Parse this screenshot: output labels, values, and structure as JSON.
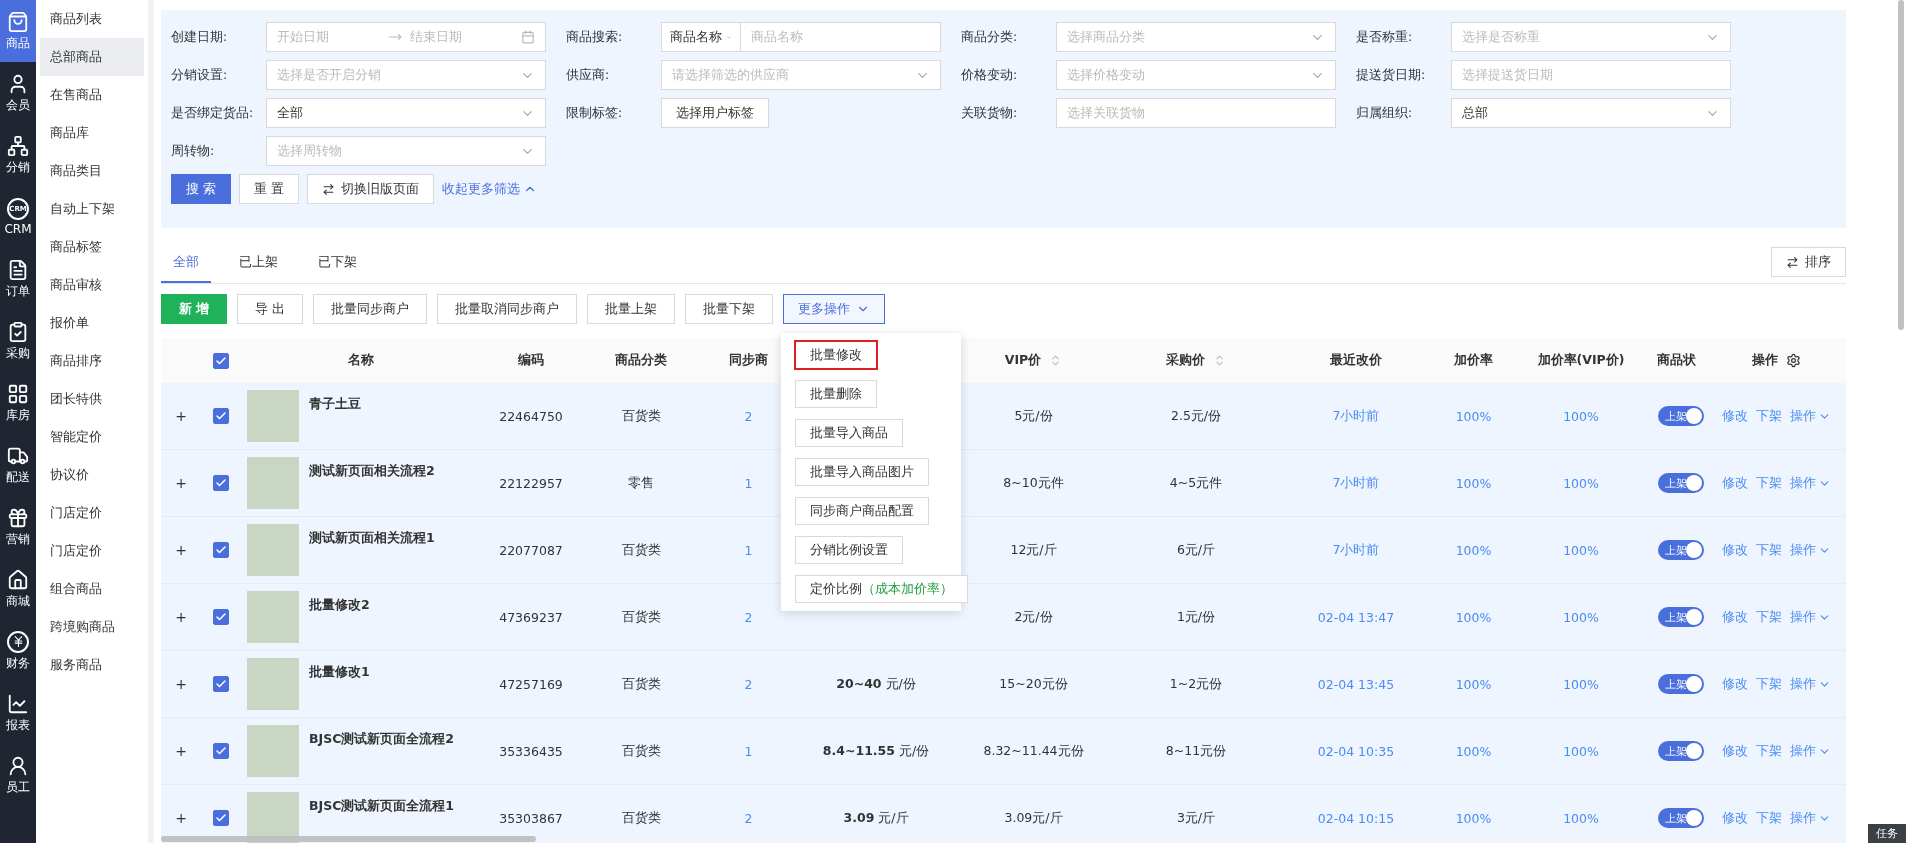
{
  "nav": [
    {
      "label": "商品",
      "selected": true
    },
    {
      "label": "会员",
      "selected": false
    },
    {
      "label": "分销",
      "selected": false
    },
    {
      "label": "CRM",
      "badge": "CRM",
      "selected": false
    },
    {
      "label": "订单",
      "selected": false
    },
    {
      "label": "采购",
      "selected": false
    },
    {
      "label": "库房",
      "selected": false
    },
    {
      "label": "配送",
      "selected": false
    },
    {
      "label": "营销",
      "selected": false
    },
    {
      "label": "商城",
      "selected": false
    },
    {
      "label": "财务",
      "selected": false
    },
    {
      "label": "报表",
      "selected": false
    },
    {
      "label": "员工",
      "selected": false
    }
  ],
  "submenu": [
    {
      "label": "商品列表",
      "selected": false
    },
    {
      "label": "总部商品",
      "selected": true
    },
    {
      "label": "在售商品",
      "selected": false
    },
    {
      "label": "商品库",
      "selected": false
    },
    {
      "label": "商品类目",
      "selected": false
    },
    {
      "label": "自动上下架",
      "selected": false
    },
    {
      "label": "商品标签",
      "selected": false
    },
    {
      "label": "商品审核",
      "selected": false
    },
    {
      "label": "报价单",
      "selected": false
    },
    {
      "label": "商品排序",
      "selected": false
    },
    {
      "label": "团长特供",
      "selected": false
    },
    {
      "label": "智能定价",
      "selected": false
    },
    {
      "label": "协议价",
      "selected": false
    },
    {
      "label": "门店定价",
      "selected": false
    },
    {
      "label": "门店定价",
      "selected": false
    },
    {
      "label": "组合商品",
      "selected": false
    },
    {
      "label": "跨境购商品",
      "selected": false
    },
    {
      "label": "服务商品",
      "selected": false
    }
  ],
  "filters": [
    {
      "label": "创建日期:",
      "kind": "daterange",
      "placeholder": "开始日期",
      "placeholder_end": "结束日期"
    },
    {
      "label": "商品搜索:",
      "kind": "combo",
      "value": "商品名称",
      "placeholder": "商品名称"
    },
    {
      "label": "商品分类:",
      "kind": "select",
      "placeholder": "选择商品分类"
    },
    {
      "label": "是否称重:",
      "kind": "select",
      "placeholder": "选择是否称重"
    },
    {
      "label": "分销设置:",
      "kind": "select",
      "placeholder": "选择是否开启分销"
    },
    {
      "label": "供应商:",
      "kind": "select",
      "placeholder": "请选择筛选的供应商"
    },
    {
      "label": "价格变动:",
      "kind": "select",
      "placeholder": "选择价格变动"
    },
    {
      "label": "提送货日期:",
      "kind": "input",
      "placeholder": "选择提送货日期"
    },
    {
      "label": "是否绑定货品:",
      "kind": "select",
      "value": "全部"
    },
    {
      "label": "限制标签:",
      "kind": "button",
      "value": "选择用户标签"
    },
    {
      "label": "关联货物:",
      "kind": "input",
      "placeholder": "选择关联货物"
    },
    {
      "label": "归属组织:",
      "kind": "select",
      "value": "总部"
    },
    {
      "label": "周转物:",
      "kind": "select",
      "placeholder": "选择周转物"
    }
  ],
  "filter_actions": {
    "search": "搜 索",
    "reset": "重 置",
    "switch": "切换旧版页面",
    "collapse": "收起更多筛选"
  },
  "tabs": [
    {
      "label": "全部",
      "selected": true
    },
    {
      "label": "已上架",
      "selected": false
    },
    {
      "label": "已下架",
      "selected": false
    }
  ],
  "sort_button": "排序",
  "toolbar": [
    {
      "label": "新 增",
      "kind": "primary"
    },
    {
      "label": "导 出",
      "kind": "default"
    },
    {
      "label": "批量同步商户",
      "kind": "default"
    },
    {
      "label": "批量取消同步商户",
      "kind": "default"
    },
    {
      "label": "批量上架",
      "kind": "default"
    },
    {
      "label": "批量下架",
      "kind": "default"
    },
    {
      "label": "更多操作",
      "kind": "dropdown",
      "expanded": true
    }
  ],
  "menu": [
    {
      "label": "批量修改",
      "selected": true
    },
    {
      "label": "批量删除",
      "selected": false
    },
    {
      "label": "批量导入商品",
      "selected": false
    },
    {
      "label": "批量导入商品图片",
      "selected": false
    },
    {
      "label": "同步商户商品配置",
      "selected": false
    },
    {
      "label": "分销比例设置",
      "selected": false
    },
    {
      "label": "定价比例",
      "note": "（成本加价率）",
      "selected": false
    }
  ],
  "table": {
    "all_checked": true,
    "columns": [
      {
        "label": "名称",
        "sortable": false
      },
      {
        "label": "编码",
        "sortable": false
      },
      {
        "label": "商品分类",
        "sortable": false
      },
      {
        "label": "同步商",
        "sortable": false
      },
      {
        "label": "VIP价",
        "sortable": true
      },
      {
        "label": "采购价",
        "sortable": true
      },
      {
        "label": "最近改价",
        "sortable": false
      },
      {
        "label": "加价率",
        "sortable": false
      },
      {
        "label": "加价率(VIP价)",
        "sortable": false
      },
      {
        "label": "商品状",
        "sortable": false
      },
      {
        "label": "操作",
        "sortable": false
      }
    ],
    "rows": [
      {
        "expand": "+",
        "checked": true,
        "name": "青子土豆",
        "code": "22464750",
        "category": "百货类",
        "sync": "2",
        "vip": "5元/份",
        "purchase": "2.5元/份",
        "changed": "7小时前",
        "markup": "100%",
        "markup_vip": "100%",
        "status": "上架",
        "on": true,
        "actions": [
          "修改",
          "下架",
          "操作"
        ]
      },
      {
        "expand": "+",
        "checked": true,
        "name": "测试新页面相关流程2",
        "code": "22122957",
        "category": "零售",
        "sync": "1",
        "vip": "8~10元件",
        "purchase": "4~5元件",
        "changed": "7小时前",
        "markup": "100%",
        "markup_vip": "100%",
        "status": "上架",
        "on": true,
        "actions": [
          "修改",
          "下架",
          "操作"
        ]
      },
      {
        "expand": "+",
        "checked": true,
        "name": "测试新页面相关流程1",
        "code": "22077087",
        "category": "百货类",
        "sync": "1",
        "vip": "12元/斤",
        "purchase": "6元/斤",
        "changed": "7小时前",
        "markup": "100%",
        "markup_vip": "100%",
        "status": "上架",
        "on": true,
        "actions": [
          "修改",
          "下架",
          "操作"
        ]
      },
      {
        "expand": "+",
        "checked": true,
        "name": "批量修改2",
        "code": "47369237",
        "category": "百货类",
        "sync": "2",
        "vip": "2元/份",
        "purchase": "1元/份",
        "changed": "02-04 13:47",
        "markup": "100%",
        "markup_vip": "100%",
        "status": "上架",
        "on": true,
        "actions": [
          "修改",
          "下架",
          "操作"
        ]
      },
      {
        "expand": "+",
        "checked": true,
        "name": "批量修改1",
        "code": "47257169",
        "category": "百货类",
        "sync": "2",
        "price": "**20~40** 元/份",
        "vip": "15~20元份",
        "purchase": "1~2元份",
        "changed": "02-04 13:45",
        "markup": "100%",
        "markup_vip": "100%",
        "status": "上架",
        "on": true,
        "actions": [
          "修改",
          "下架",
          "操作"
        ]
      },
      {
        "expand": "+",
        "checked": true,
        "name": "BJSC测试新页面全流程2",
        "code": "35336435",
        "category": "百货类",
        "sync": "1",
        "price": "**8.4~11.55** 元/份",
        "vip": "8.32~11.44元份",
        "purchase": "8~11元份",
        "changed": "02-04 10:35",
        "markup": "100%",
        "markup_vip": "100%",
        "status": "上架",
        "on": true,
        "actions": [
          "修改",
          "下架",
          "操作"
        ]
      },
      {
        "expand": "+",
        "checked": true,
        "name": "BJSC测试新页面全流程1",
        "code": "35303867",
        "category": "百货类",
        "sync": "2",
        "price": "**3.09** 元/斤",
        "vip": "3.09元/斤",
        "purchase": "3元/斤",
        "changed": "02-04 10:15",
        "markup": "100%",
        "markup_vip": "100%",
        "status": "上架",
        "on": true,
        "actions": [
          "修改",
          "下架",
          "操作"
        ]
      }
    ]
  },
  "task_tab": "任务"
}
